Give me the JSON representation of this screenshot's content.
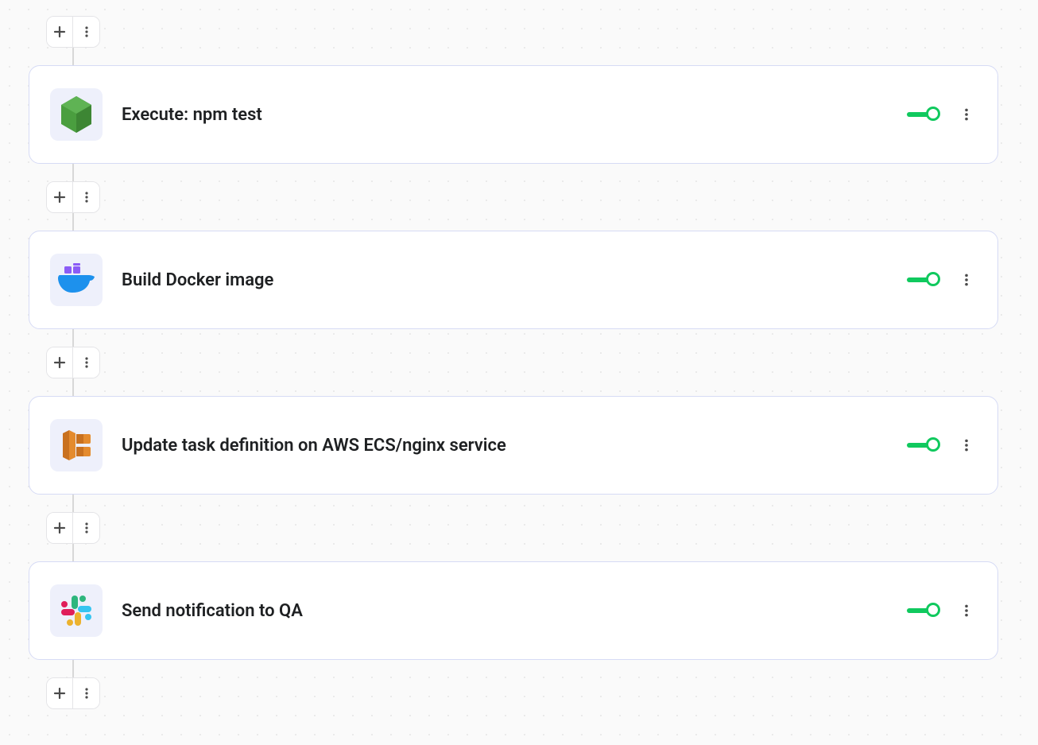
{
  "pipeline": {
    "steps": [
      {
        "icon": "nodejs-icon",
        "title": "Execute: npm test",
        "enabled": true
      },
      {
        "icon": "docker-icon",
        "title": "Build Docker image",
        "enabled": true
      },
      {
        "icon": "aws-ecs-icon",
        "title": "Update task definition on AWS ECS/nginx service",
        "enabled": true
      },
      {
        "icon": "slack-icon",
        "title": "Send notification to QA",
        "enabled": true
      }
    ],
    "colors": {
      "card_border": "#d6dbf5",
      "icon_bg": "#eef0fb",
      "toggle_on": "#10c95e",
      "node_green": "#4a9e3f",
      "docker_blue": "#1d91ed",
      "docker_purple": "#8b5cf6",
      "ecs_orange": "#e48b2e",
      "slack_green": "#2eb67d",
      "slack_blue": "#36c5f0",
      "slack_red": "#e01e5a",
      "slack_yellow": "#ecb22e"
    }
  }
}
